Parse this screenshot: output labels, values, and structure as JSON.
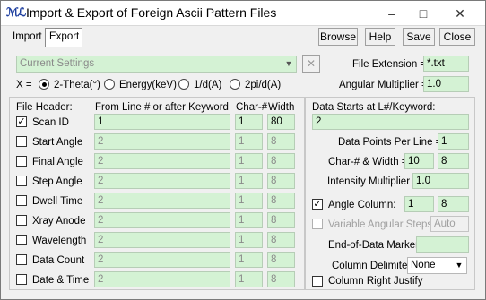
{
  "window": {
    "icon_text": "ℳℒ",
    "title": "Import & Export of Foreign Ascii Pattern Files",
    "minimize": "–",
    "maximize": "□",
    "close": "✕"
  },
  "tabs": [
    {
      "label": "Import",
      "active": false
    },
    {
      "label": "Export",
      "active": true
    }
  ],
  "toolbar": {
    "browse": "Browse",
    "help": "Help",
    "save": "Save",
    "close": "Close"
  },
  "settings": {
    "value": "Current Settings",
    "clear_icon": "✕"
  },
  "file_extension": {
    "label": "File Extension =",
    "value": "*.txt"
  },
  "x_axis": {
    "label": "X =",
    "options": [
      {
        "label": "2-Theta(°)",
        "selected": true
      },
      {
        "label": "Energy(keV)",
        "selected": false
      },
      {
        "label": "1/d(A)",
        "selected": false
      },
      {
        "label": "2pi/d(A)",
        "selected": false
      }
    ]
  },
  "angular_multiplier": {
    "label": "Angular Multiplier =",
    "value": "1.0"
  },
  "header_table": {
    "col_header": "File Header:",
    "col_from": "From Line # or after Keyword",
    "col_char": "Char-#",
    "col_width": "Width",
    "rows": [
      {
        "label": "Scan ID",
        "checked": true,
        "from": "1",
        "char": "1",
        "width": "80"
      },
      {
        "label": "Start Angle",
        "checked": false,
        "from": "2",
        "char": "1",
        "width": "8"
      },
      {
        "label": "Final Angle",
        "checked": false,
        "from": "2",
        "char": "1",
        "width": "8"
      },
      {
        "label": "Step Angle",
        "checked": false,
        "from": "2",
        "char": "1",
        "width": "8"
      },
      {
        "label": "Dwell Time",
        "checked": false,
        "from": "2",
        "char": "1",
        "width": "8"
      },
      {
        "label": "Xray Anode",
        "checked": false,
        "from": "2",
        "char": "1",
        "width": "8"
      },
      {
        "label": "Wavelength",
        "checked": false,
        "from": "2",
        "char": "1",
        "width": "8"
      },
      {
        "label": "Data Count",
        "checked": false,
        "from": "2",
        "char": "1",
        "width": "8"
      },
      {
        "label": "Date & Time",
        "checked": false,
        "from": "2",
        "char": "1",
        "width": "8"
      }
    ]
  },
  "data_panel": {
    "data_starts_label": "Data Starts at L#/Keyword:",
    "data_starts_value": "2",
    "points_per_line_label": "Data Points Per Line =",
    "points_per_line_value": "1",
    "char_width_label": "Char-# & Width =",
    "char_value": "10",
    "width_value": "8",
    "intensity_label": "Intensity Multiplier =",
    "intensity_value": "1.0",
    "angle_column_label": "Angle Column:",
    "angle_column_checked": true,
    "angle_col_a": "1",
    "angle_col_b": "8",
    "var_steps_label": "Variable Angular Steps:",
    "var_steps_checked": false,
    "var_steps_value": "Auto",
    "end_marker_label": "End-of-Data Marker:",
    "end_marker_value": "",
    "delimiter_label": "Column Delimiter:",
    "delimiter_value": "None",
    "right_justify_label": "Column Right Justify",
    "right_justify_checked": false
  }
}
